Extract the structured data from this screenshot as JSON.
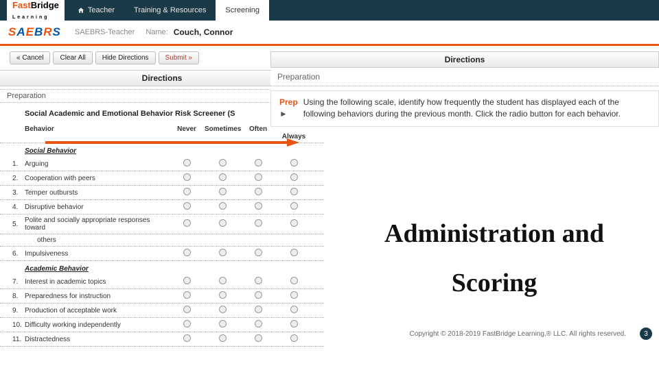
{
  "topbar": {
    "logo": "FastBridge Learning",
    "nav": [
      "Teacher",
      "Training & Resources",
      "Screening"
    ]
  },
  "secondbar": {
    "logo": "SAEBRS",
    "crumb": "SAEBRS-Teacher",
    "name_label": "Name:",
    "name_value": "Couch, Connor"
  },
  "toolbar": {
    "cancel": "« Cancel",
    "clear": "Clear All",
    "hide": "Hide Directions",
    "submit": "Submit »"
  },
  "sections": {
    "directions": "Directions",
    "preparation": "Preparation",
    "asmt_title": "Social Academic and Emotional Behavior Risk Screener (S"
  },
  "table": {
    "header_label": "Behavior",
    "options": [
      "Never",
      "Sometimes",
      "Often",
      "Almost Always"
    ],
    "cat1": "Social Behavior",
    "cat2": "Academic Behavior",
    "items1": [
      {
        "n": "1.",
        "t": "Arguing"
      },
      {
        "n": "2.",
        "t": "Cooperation with peers"
      },
      {
        "n": "3.",
        "t": "Temper outbursts"
      },
      {
        "n": "4.",
        "t": "Disruptive behavior"
      },
      {
        "n": "5.",
        "t": "Polite and socially appropriate responses toward"
      },
      {
        "n": "",
        "t": "others",
        "sub": true
      },
      {
        "n": "6.",
        "t": "Impulsiveness"
      }
    ],
    "items2": [
      {
        "n": "7.",
        "t": "Interest in academic topics"
      },
      {
        "n": "8.",
        "t": "Preparedness for instruction"
      },
      {
        "n": "9.",
        "t": "Production of acceptable work"
      },
      {
        "n": "10.",
        "t": "Difficulty working independently"
      },
      {
        "n": "11.",
        "t": "Distractedness"
      }
    ]
  },
  "overlay": {
    "directions": "Directions",
    "preparation": "Preparation",
    "prep_tag": "Prep",
    "prep_text": "Using the following scale, identify how frequently the student has displayed each of the following behaviors during the previous month. Click the radio button for each behavior."
  },
  "big_title_1": "Administration and",
  "big_title_2": "Scoring",
  "footer": {
    "copyright": "Copyright © 2018-2019 FastBridge Learning,® LLC. All rights reserved.",
    "page": "3"
  },
  "colors": {
    "accent": "#e85412",
    "navy": "#1a3a47",
    "blue": "#0057a8"
  }
}
